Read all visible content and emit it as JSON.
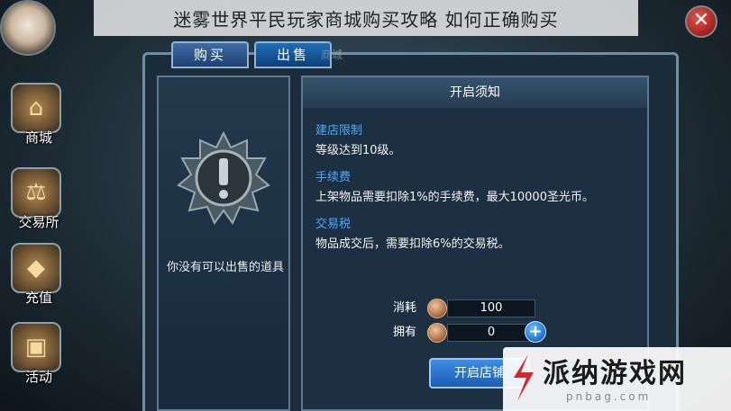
{
  "banner": {
    "title": "迷雾世界平民玩家商城购买攻略 如何正确购买"
  },
  "close_label": "✕",
  "sidebar": {
    "items": [
      {
        "label": "商城",
        "icon": "shop-icon",
        "glyph": "⌂"
      },
      {
        "label": "交易所",
        "icon": "scales-icon",
        "glyph": "⚖"
      },
      {
        "label": "充值",
        "icon": "crystal-icon",
        "glyph": "◆"
      },
      {
        "label": "活动",
        "icon": "treasure-icon",
        "glyph": "▣"
      }
    ]
  },
  "tabs": [
    {
      "label": "购买",
      "active": false
    },
    {
      "label": "出售",
      "active": true
    }
  ],
  "hidden_label": "商城",
  "left_panel": {
    "empty_text": "你没有可以出售的道具"
  },
  "notice": {
    "header": "开启须知",
    "sections": [
      {
        "title": "建店限制",
        "body": "等级达到10级。"
      },
      {
        "title": "手续费",
        "body": "上架物品需要扣除1%的手续费，最大10000圣光币。"
      },
      {
        "title": "交易税",
        "body": "物品成交后，需要扣除6%的交易税。"
      }
    ]
  },
  "resources": [
    {
      "label": "消耗",
      "value": "100"
    },
    {
      "label": "拥有",
      "value": "0"
    }
  ],
  "plus_label": "+",
  "open_button": {
    "label": "开启店铺"
  },
  "watermark": {
    "text": "派纳游戏网",
    "sub": "pnbag.com"
  },
  "colors": {
    "accent": "#4fa7ff",
    "panel": "#1b2d3b",
    "button": "#1c5cb0"
  }
}
